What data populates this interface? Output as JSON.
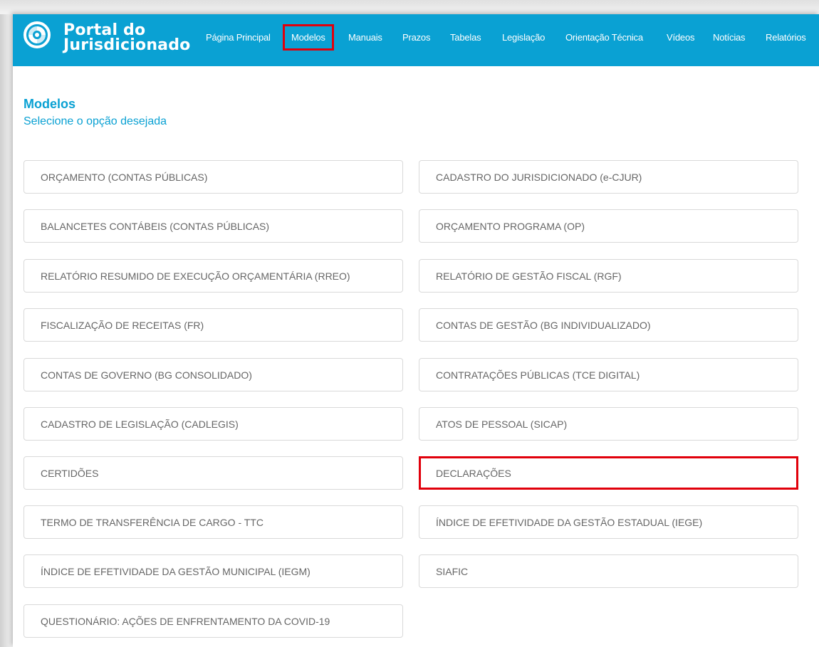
{
  "header": {
    "brand_line1": "Portal do",
    "brand_line2": "Jurisdicionado",
    "logo_icon": "portal-logo-icon",
    "nav": [
      {
        "label": "Página Principal"
      },
      {
        "label": "Modelos",
        "active": true
      },
      {
        "label": "Manuais"
      },
      {
        "label": "Prazos"
      },
      {
        "label": "Tabelas"
      },
      {
        "label": "Legislação"
      },
      {
        "label": "Orientação Técnica"
      },
      {
        "label": "Vídeos"
      },
      {
        "label": "Notícias"
      },
      {
        "label": "Relatórios"
      }
    ]
  },
  "main": {
    "title": "Modelos",
    "subtitle": "Selecione o opção desejada",
    "options_left": [
      "ORÇAMENTO (CONTAS PÚBLICAS)",
      "BALANCETES CONTÁBEIS (CONTAS PÚBLICAS)",
      "RELATÓRIO RESUMIDO DE EXECUÇÃO ORÇAMENTÁRIA (RREO)",
      "FISCALIZAÇÃO DE RECEITAS (FR)",
      "CONTAS DE GOVERNO (BG CONSOLIDADO)",
      "CADASTRO DE LEGISLAÇÃO (CADLEGIS)",
      "CERTIDÕES",
      "TERMO DE TRANSFERÊNCIA DE CARGO - TTC",
      "ÍNDICE DE EFETIVIDADE DA GESTÃO MUNICIPAL (IEGM)",
      "QUESTIONÁRIO: AÇÕES DE ENFRENTAMENTO DA COVID-19"
    ],
    "options_right": [
      "CADASTRO DO JURISDICIONADO (e-CJUR)",
      "ORÇAMENTO PROGRAMA (OP)",
      "RELATÓRIO DE GESTÃO FISCAL (RGF)",
      "CONTAS DE GESTÃO (BG INDIVIDUALIZADO)",
      "CONTRATAÇÕES PÚBLICAS (TCE DIGITAL)",
      "ATOS DE PESSOAL (SICAP)",
      "DECLARAÇÕES",
      "ÍNDICE DE EFETIVIDADE DA GESTÃO ESTADUAL (IEGE)",
      "SIAFIC"
    ],
    "highlighted_option": "DECLARAÇÕES"
  },
  "colors": {
    "header_bg": "#0aa1d3",
    "accent_text": "#0aa1d3",
    "highlight_border": "#e1000b",
    "card_text": "#666666",
    "card_border": "#d9d9d9"
  }
}
